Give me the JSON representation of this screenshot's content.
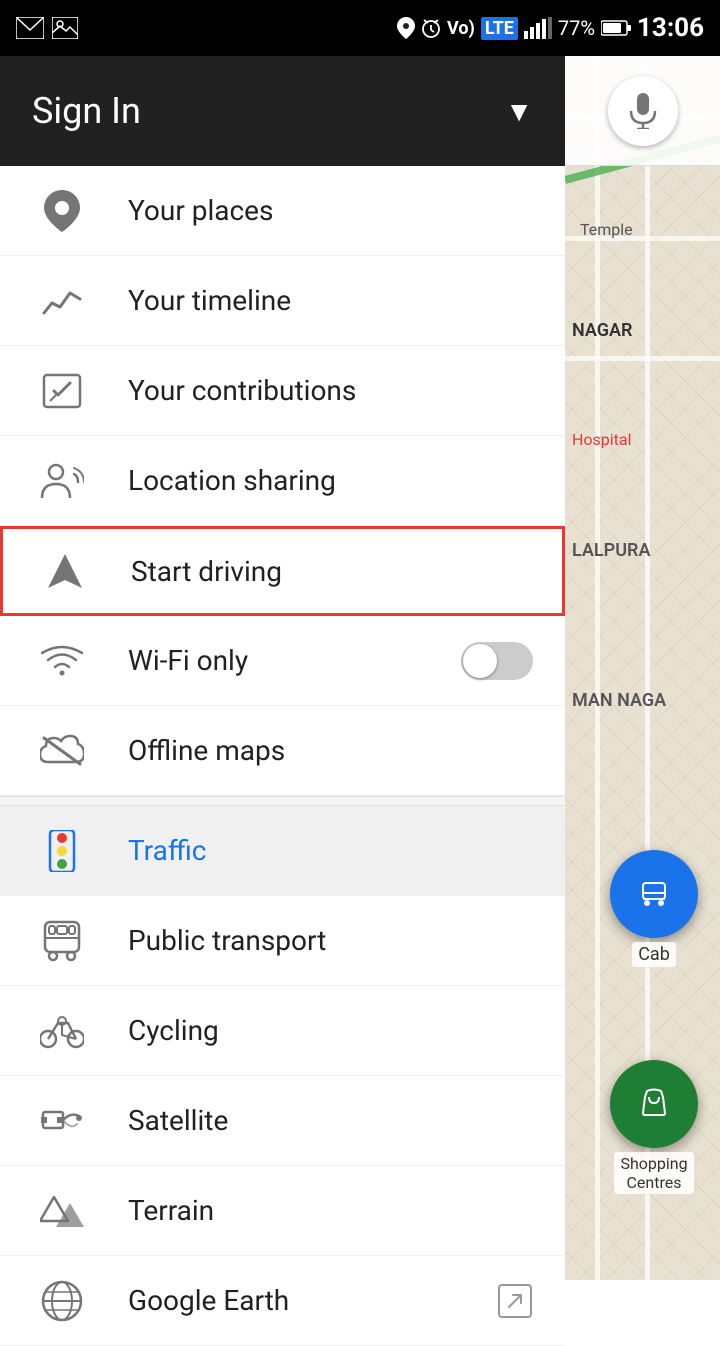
{
  "statusBar": {
    "time": "13:06",
    "battery": "77%",
    "signal": "LTE",
    "leftIcons": [
      "gmail-icon",
      "image-icon"
    ]
  },
  "header": {
    "title": "Sign In",
    "dropdownLabel": "▼"
  },
  "menuItems": [
    {
      "id": "your-places",
      "label": "Your places",
      "icon": "location-pin",
      "active": false,
      "highlighted": false,
      "hasToggle": false,
      "hasArrow": false,
      "isBlue": false
    },
    {
      "id": "your-timeline",
      "label": "Your timeline",
      "icon": "timeline",
      "active": false,
      "highlighted": false,
      "hasToggle": false,
      "hasArrow": false,
      "isBlue": false
    },
    {
      "id": "your-contributions",
      "label": "Your contributions",
      "icon": "contributions",
      "active": false,
      "highlighted": false,
      "hasToggle": false,
      "hasArrow": false,
      "isBlue": false
    },
    {
      "id": "location-sharing",
      "label": "Location sharing",
      "icon": "person-share",
      "active": false,
      "highlighted": false,
      "hasToggle": false,
      "hasArrow": false,
      "isBlue": false
    },
    {
      "id": "start-driving",
      "label": "Start driving",
      "icon": "navigation",
      "active": false,
      "highlighted": true,
      "hasToggle": false,
      "hasArrow": false,
      "isBlue": false
    },
    {
      "id": "wifi-only",
      "label": "Wi-Fi only",
      "icon": "wifi",
      "active": false,
      "highlighted": false,
      "hasToggle": true,
      "hasArrow": false,
      "isBlue": false
    },
    {
      "id": "offline-maps",
      "label": "Offline maps",
      "icon": "cloud-off",
      "active": false,
      "highlighted": false,
      "hasToggle": false,
      "hasArrow": false,
      "isBlue": false
    },
    {
      "id": "traffic",
      "label": "Traffic",
      "icon": "traffic",
      "active": true,
      "highlighted": false,
      "hasToggle": false,
      "hasArrow": false,
      "isBlue": true
    },
    {
      "id": "public-transport",
      "label": "Public transport",
      "icon": "train",
      "active": false,
      "highlighted": false,
      "hasToggle": false,
      "hasArrow": false,
      "isBlue": false
    },
    {
      "id": "cycling",
      "label": "Cycling",
      "icon": "cycling",
      "active": false,
      "highlighted": false,
      "hasToggle": false,
      "hasArrow": false,
      "isBlue": false
    },
    {
      "id": "satellite",
      "label": "Satellite",
      "icon": "satellite",
      "active": false,
      "highlighted": false,
      "hasToggle": false,
      "hasArrow": false,
      "isBlue": false
    },
    {
      "id": "terrain",
      "label": "Terrain",
      "icon": "terrain",
      "active": false,
      "highlighted": false,
      "hasToggle": false,
      "hasArrow": false,
      "isBlue": false
    },
    {
      "id": "google-earth",
      "label": "Google Earth",
      "icon": "google-earth",
      "active": false,
      "highlighted": false,
      "hasToggle": false,
      "hasArrow": true,
      "isBlue": false
    }
  ],
  "map": {
    "fabTransitLabel": "Cab",
    "fabShoppingLabel": "Shopping\nCentres"
  }
}
